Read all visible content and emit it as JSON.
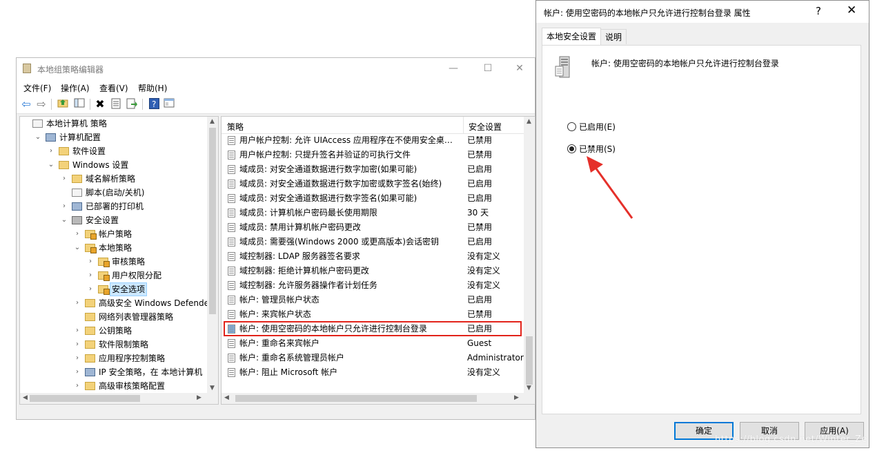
{
  "gpedit": {
    "title": "本地组策略编辑器",
    "window_controls": {
      "minimize": "—",
      "maximize": "☐",
      "close": "✕"
    },
    "menu": [
      "文件(F)",
      "操作(A)",
      "查看(V)",
      "帮助(H)"
    ],
    "toolbar_icons": [
      "back-icon",
      "forward-icon",
      "up-folder-icon",
      "show-hide-tree-icon",
      "delete-icon",
      "properties-icon",
      "export-list-icon",
      "help-icon",
      "console-view-icon"
    ],
    "tree": [
      {
        "label": "本地计算机 策略",
        "level": 0,
        "expander": "",
        "icon": "policy-icon"
      },
      {
        "label": "计算机配置",
        "level": 1,
        "expander": "⌄",
        "icon": "computer-icon"
      },
      {
        "label": "软件设置",
        "level": 2,
        "expander": "›",
        "icon": "folder-icon"
      },
      {
        "label": "Windows 设置",
        "level": 2,
        "expander": "⌄",
        "icon": "folder-icon"
      },
      {
        "label": "域名解析策略",
        "level": 3,
        "expander": "›",
        "icon": "folder-icon"
      },
      {
        "label": "脚本(启动/关机)",
        "level": 3,
        "expander": "",
        "icon": "script-icon"
      },
      {
        "label": "已部署的打印机",
        "level": 3,
        "expander": "›",
        "icon": "printer-icon"
      },
      {
        "label": "安全设置",
        "level": 3,
        "expander": "⌄",
        "icon": "security-icon"
      },
      {
        "label": "帐户策略",
        "level": 4,
        "expander": "›",
        "icon": "locked-folder-icon"
      },
      {
        "label": "本地策略",
        "level": 4,
        "expander": "⌄",
        "icon": "locked-folder-icon"
      },
      {
        "label": "审核策略",
        "level": 5,
        "expander": "›",
        "icon": "locked-folder-icon"
      },
      {
        "label": "用户权限分配",
        "level": 5,
        "expander": "›",
        "icon": "locked-folder-icon"
      },
      {
        "label": "安全选项",
        "level": 5,
        "expander": "›",
        "icon": "locked-folder-icon",
        "selected": true
      },
      {
        "label": "高级安全 Windows Defender 防",
        "level": 4,
        "expander": "›",
        "icon": "folder-icon"
      },
      {
        "label": "网络列表管理器策略",
        "level": 4,
        "expander": "",
        "icon": "folder-icon"
      },
      {
        "label": "公钥策略",
        "level": 4,
        "expander": "›",
        "icon": "folder-icon"
      },
      {
        "label": "软件限制策略",
        "level": 4,
        "expander": "›",
        "icon": "folder-icon"
      },
      {
        "label": "应用程序控制策略",
        "level": 4,
        "expander": "›",
        "icon": "folder-icon"
      },
      {
        "label": "IP 安全策略，在 本地计算机",
        "level": 4,
        "expander": "›",
        "icon": "ipsec-icon"
      },
      {
        "label": "高级审核策略配置",
        "level": 4,
        "expander": "›",
        "icon": "folder-icon"
      }
    ],
    "list": {
      "headers": {
        "policy": "策略",
        "setting": "安全设置"
      },
      "rows": [
        {
          "policy": "用户帐户控制: 允许 UIAccess 应用程序在不使用安全桌面的情况下提升权限",
          "setting": "已禁用"
        },
        {
          "policy": "用户帐户控制: 只提升签名并验证的可执行文件",
          "setting": "已禁用"
        },
        {
          "policy": "域成员: 对安全通道数据进行数字加密(如果可能)",
          "setting": "已启用"
        },
        {
          "policy": "域成员: 对安全通道数据进行数字加密或数字签名(始终)",
          "setting": "已启用"
        },
        {
          "policy": "域成员: 对安全通道数据进行数字签名(如果可能)",
          "setting": "已启用"
        },
        {
          "policy": "域成员: 计算机帐户密码最长使用期限",
          "setting": "30 天"
        },
        {
          "policy": "域成员: 禁用计算机帐户密码更改",
          "setting": "已禁用"
        },
        {
          "policy": "域成员: 需要强(Windows 2000 或更高版本)会话密钥",
          "setting": "已启用"
        },
        {
          "policy": "域控制器: LDAP 服务器签名要求",
          "setting": "没有定义"
        },
        {
          "policy": "域控制器: 拒绝计算机帐户密码更改",
          "setting": "没有定义"
        },
        {
          "policy": "域控制器: 允许服务器操作者计划任务",
          "setting": "没有定义"
        },
        {
          "policy": "帐户: 管理员帐户状态",
          "setting": "已启用"
        },
        {
          "policy": "帐户: 来宾帐户状态",
          "setting": "已禁用"
        },
        {
          "policy": "帐户: 使用空密码的本地帐户只允许进行控制台登录",
          "setting": "已启用",
          "highlighted": true
        },
        {
          "policy": "帐户: 重命名来宾帐户",
          "setting": "Guest"
        },
        {
          "policy": "帐户: 重命名系统管理员帐户",
          "setting": "Administrator"
        },
        {
          "policy": "帐户: 阻止 Microsoft 帐户",
          "setting": "没有定义"
        }
      ]
    }
  },
  "dialog": {
    "title": "帐户: 使用空密码的本地帐户只允许进行控制台登录 属性",
    "help_glyph": "?",
    "close_glyph": "✕",
    "tabs": [
      "本地安全设置",
      "说明"
    ],
    "active_tab": 0,
    "policy_name": "帐户: 使用空密码的本地帐户只允许进行控制台登录",
    "options": [
      {
        "label": "已启用(E)",
        "checked": false
      },
      {
        "label": "已禁用(S)",
        "checked": true
      }
    ],
    "buttons": {
      "ok": "确定",
      "cancel": "取消",
      "apply": "应用(A)"
    },
    "annotation_color": "#e5302a"
  },
  "watermark": "https://blog.csdn.net/Winter_Ze"
}
